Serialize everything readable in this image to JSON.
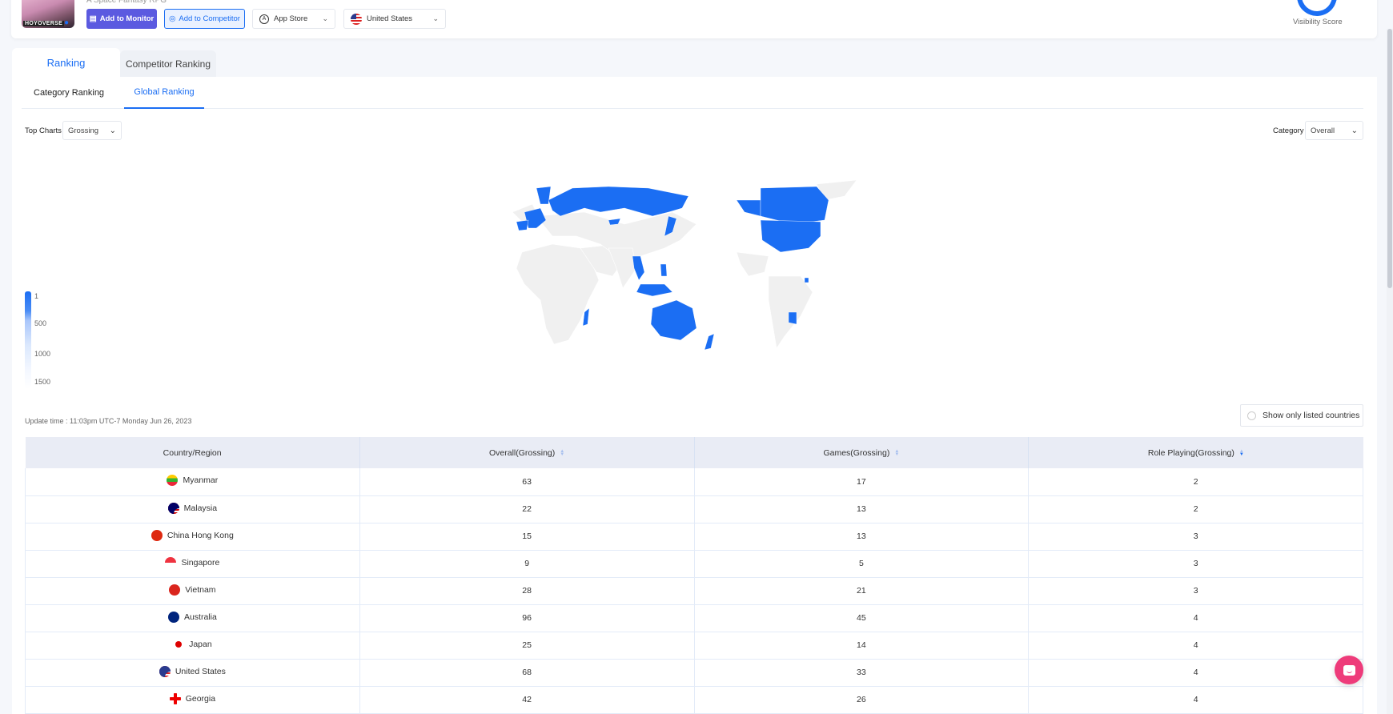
{
  "app": {
    "subtitle": "A Space Fantasy RPG",
    "icon_brand": "HOYOVERSE",
    "platform_badge": "apple-icon",
    "add_to_monitor": "Add to Monitor",
    "add_to_competitor": "Add to Competitor",
    "store_select": "App Store",
    "country_select": "United States",
    "visibility_label": "Visibility Score"
  },
  "tabs": {
    "main": [
      {
        "label": "Ranking",
        "active": true
      },
      {
        "label": "Competitor Ranking",
        "active": false
      }
    ],
    "sub": [
      {
        "label": "Category Ranking",
        "active": false
      },
      {
        "label": "Global Ranking",
        "active": true
      }
    ]
  },
  "filters": {
    "top_charts_label": "Top Charts",
    "top_charts_value": "Grossing",
    "category_label": "Category",
    "category_value": "Overall"
  },
  "map": {
    "legend_ticks": [
      "1",
      "500",
      "1000",
      "1500"
    ],
    "highlight_color": "#1b6ef3",
    "base_color": "#f0f0f0"
  },
  "update_time": "Update time : 11:03pm UTC-7 Monday Jun 26, 2023",
  "show_only_listed": "Show only listed countries",
  "table": {
    "headers": [
      "Country/Region",
      "Overall(Grossing)",
      "Games(Grossing)",
      "Role Playing(Grossing)"
    ],
    "rows": [
      {
        "country": "Myanmar",
        "flag": "myanmar",
        "overall": "63",
        "games": "17",
        "rpg": "2"
      },
      {
        "country": "Malaysia",
        "flag": "malaysia",
        "overall": "22",
        "games": "13",
        "rpg": "2"
      },
      {
        "country": "China Hong Kong",
        "flag": "hongkong",
        "overall": "15",
        "games": "13",
        "rpg": "3"
      },
      {
        "country": "Singapore",
        "flag": "singapore",
        "overall": "9",
        "games": "5",
        "rpg": "3"
      },
      {
        "country": "Vietnam",
        "flag": "vietnam",
        "overall": "28",
        "games": "21",
        "rpg": "3"
      },
      {
        "country": "Australia",
        "flag": "australia",
        "overall": "96",
        "games": "45",
        "rpg": "4"
      },
      {
        "country": "Japan",
        "flag": "japan",
        "overall": "25",
        "games": "14",
        "rpg": "4"
      },
      {
        "country": "United States",
        "flag": "us",
        "overall": "68",
        "games": "33",
        "rpg": "4"
      },
      {
        "country": "Georgia",
        "flag": "georgia",
        "overall": "42",
        "games": "26",
        "rpg": "4"
      }
    ]
  }
}
